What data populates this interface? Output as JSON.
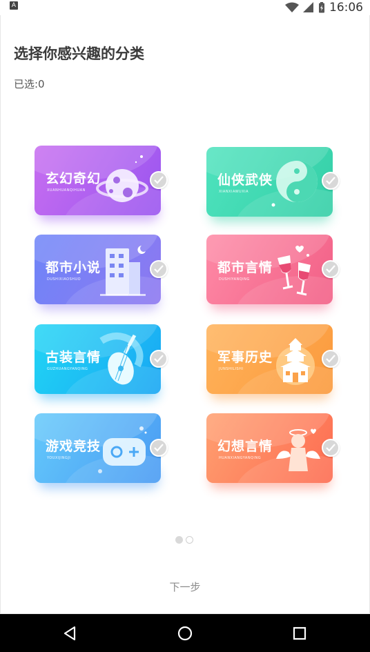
{
  "status_bar": {
    "left_icon_letter": "A",
    "time": "16:06",
    "icons": [
      "wifi-icon",
      "signal-icon",
      "battery-icon"
    ]
  },
  "header": {
    "title": "选择你感兴趣的分类",
    "selected_count": "已选:0"
  },
  "categories": [
    {
      "label": "玄幻奇幻",
      "pinyin": "XUANHUANQIHUAN",
      "icon": "planet-icon",
      "colors": [
        "#c76ef0",
        "#9a55f0"
      ]
    },
    {
      "label": "仙侠武侠",
      "pinyin": "XIANXIAWUXIA",
      "icon": "yin-yang-icon",
      "colors": [
        "#4fe3be",
        "#34cfa7"
      ]
    },
    {
      "label": "都市小说",
      "pinyin": "DUSHIXIAOSHUO",
      "icon": "building-icon",
      "colors": [
        "#6e85f8",
        "#8e78f1"
      ]
    },
    {
      "label": "都市言情",
      "pinyin": "DUSHIYANQING",
      "icon": "wine-glasses-icon",
      "colors": [
        "#fe8aa6",
        "#f25f86"
      ]
    },
    {
      "label": "古装言情",
      "pinyin": "GUZHUANGYANQING",
      "icon": "pipa-icon",
      "colors": [
        "#21d5f5",
        "#19a7f3"
      ]
    },
    {
      "label": "军事历史",
      "pinyin": "JUNSHILISHI",
      "icon": "pagoda-icon",
      "colors": [
        "#ffb25a",
        "#fb9a3d"
      ]
    },
    {
      "label": "游戏竞技",
      "pinyin": "YOUXIJINGJI",
      "icon": "gamepad-icon",
      "colors": [
        "#64c9fb",
        "#4a9bf3"
      ]
    },
    {
      "label": "幻想言情",
      "pinyin": "HUANXIANGYANQING",
      "icon": "cupid-icon",
      "colors": [
        "#ff9f70",
        "#fd6c51"
      ]
    }
  ],
  "pager": {
    "pages": 2,
    "current": 1
  },
  "next_button": "下一步",
  "nav": [
    "back-icon",
    "home-icon",
    "recents-icon"
  ]
}
